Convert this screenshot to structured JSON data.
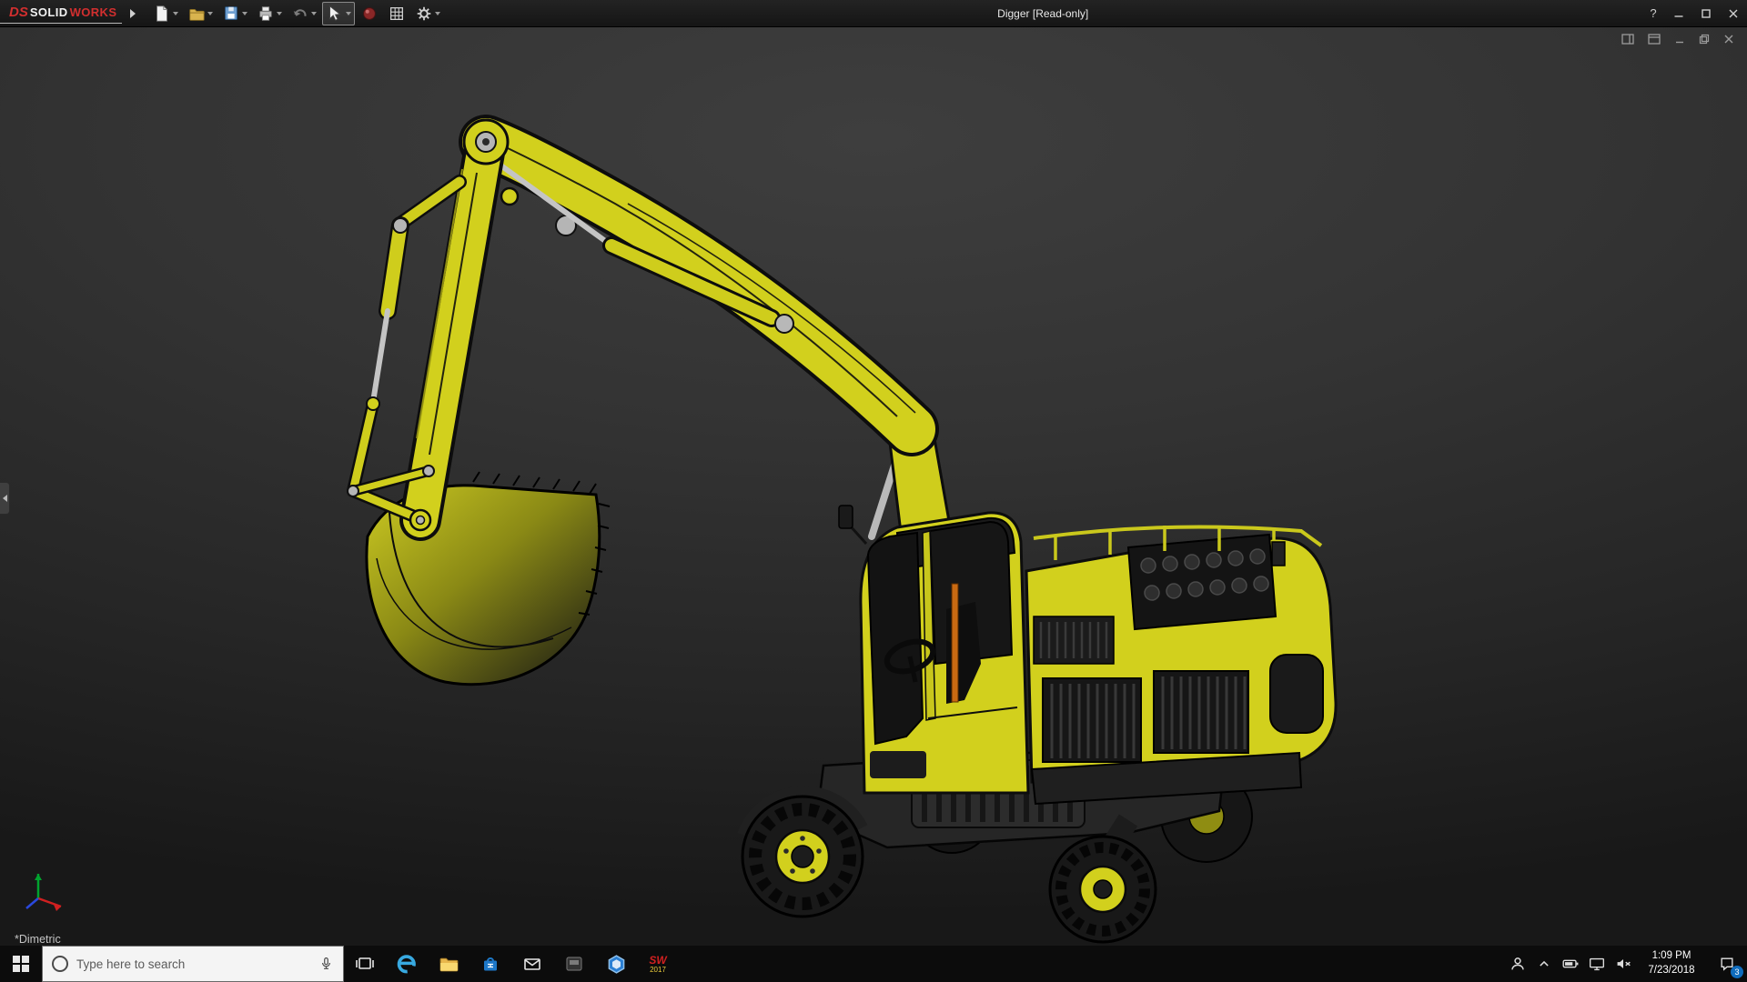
{
  "titlebar": {
    "brand": {
      "ds": "DS",
      "solid": "SOLID",
      "works": "WORKS"
    },
    "title": "Digger [Read-only]",
    "help_label": "?"
  },
  "viewport": {
    "view_orientation": "*Dimetric"
  },
  "taskbar": {
    "search_placeholder": "Type here to search",
    "sw_app_label": "SW",
    "sw_app_year": "2017",
    "time": "1:09 PM",
    "date": "7/23/2018",
    "notification_count": "3"
  },
  "model": {
    "name": "Digger",
    "body_color": "#d2d01d",
    "outline_color": "#0d0d0d",
    "metal_color": "#bcbcbc",
    "background_top": "#3e3e3e",
    "background_bottom": "#181818"
  },
  "icons": {
    "toolbar": [
      "new-document",
      "open",
      "save",
      "print",
      "undo",
      "select",
      "appearance",
      "display-grid",
      "settings"
    ],
    "taskbar": [
      "start",
      "task-view",
      "edge",
      "file-explorer",
      "store",
      "mail",
      "generic-app",
      "hexagon-app",
      "solidworks-2017"
    ],
    "tray": [
      "people",
      "hidden-icons-chevron",
      "battery",
      "network",
      "volume-muted",
      "action-center"
    ]
  }
}
